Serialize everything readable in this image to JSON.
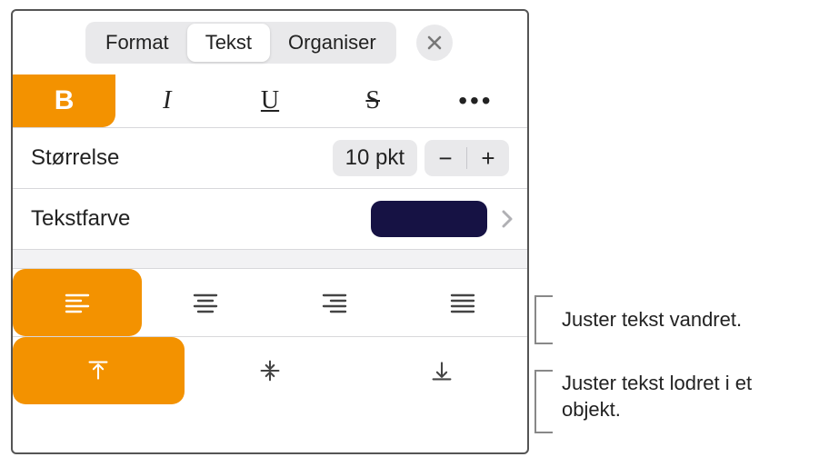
{
  "tabs": {
    "format": "Format",
    "text": "Tekst",
    "organize": "Organiser"
  },
  "font_style": {
    "bold": "B",
    "italic": "I",
    "underline": "U",
    "strike": "S",
    "more": "•••"
  },
  "size": {
    "label": "Størrelse",
    "value": "10 pkt",
    "minus": "−",
    "plus": "+"
  },
  "color": {
    "label": "Tekstfarve",
    "swatch": "#161244"
  },
  "callouts": {
    "horizontal": "Juster tekst vandret.",
    "vertical": "Juster tekst lodret i et objekt."
  }
}
